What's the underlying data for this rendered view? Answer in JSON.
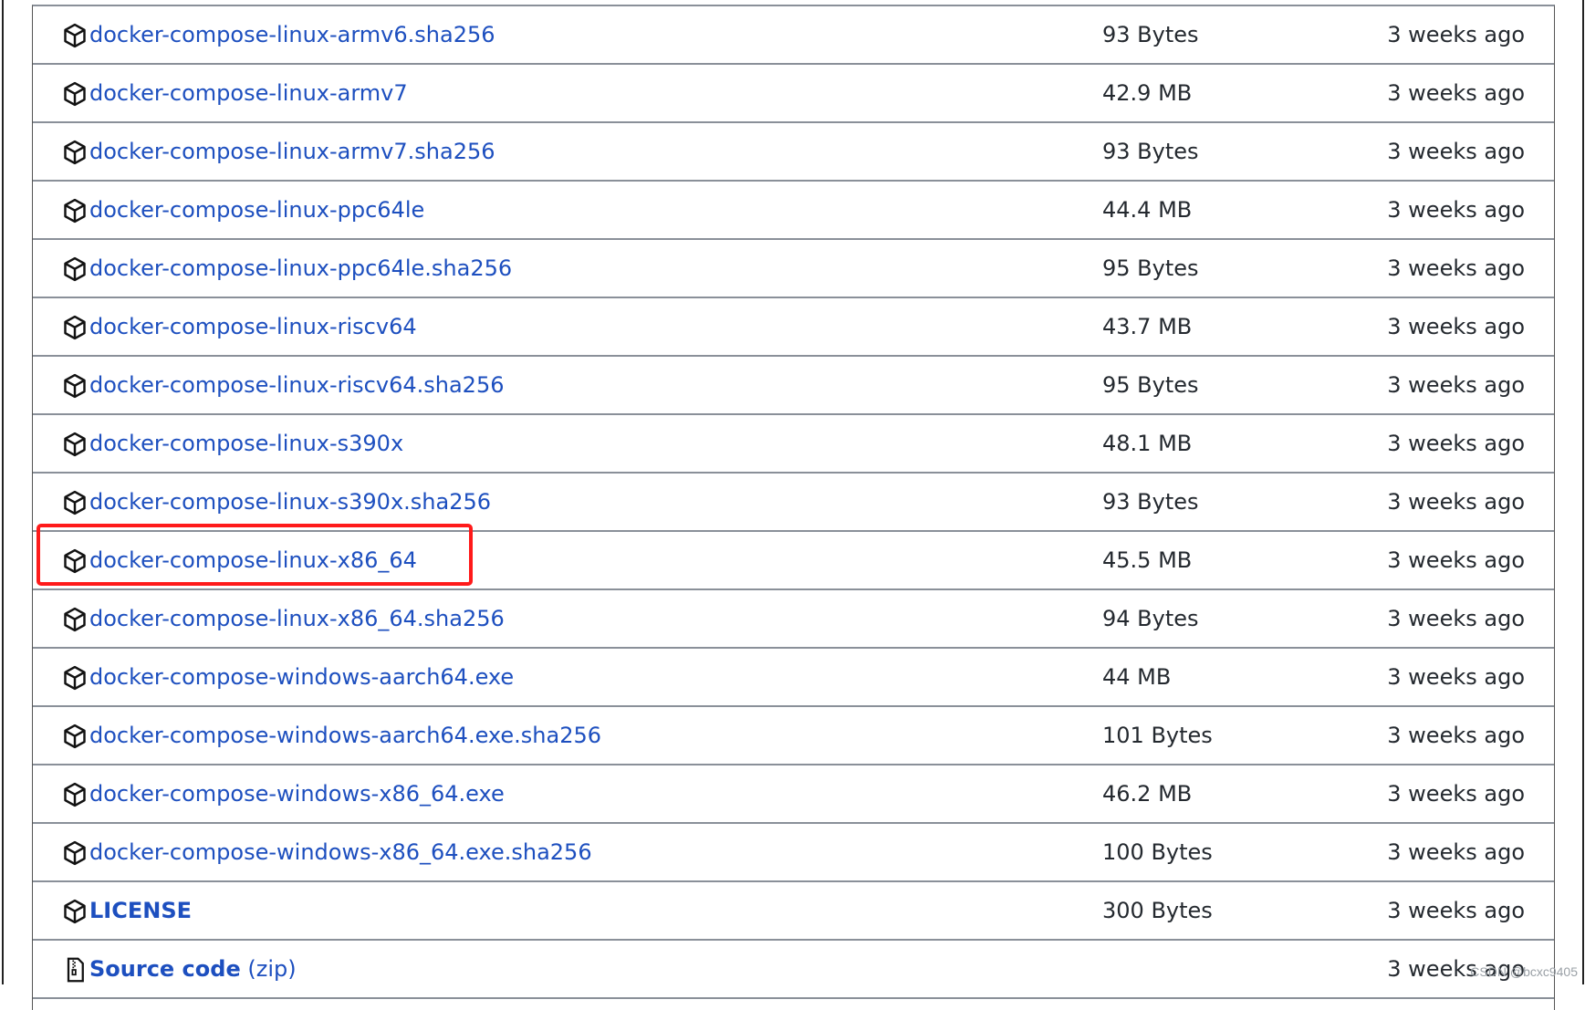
{
  "assets": [
    {
      "name": "docker-compose-linux-armv6.sha256",
      "size": "93 Bytes",
      "date": "3 weeks ago",
      "icon": "package-icon"
    },
    {
      "name": "docker-compose-linux-armv7",
      "size": "42.9 MB",
      "date": "3 weeks ago",
      "icon": "package-icon"
    },
    {
      "name": "docker-compose-linux-armv7.sha256",
      "size": "93 Bytes",
      "date": "3 weeks ago",
      "icon": "package-icon"
    },
    {
      "name": "docker-compose-linux-ppc64le",
      "size": "44.4 MB",
      "date": "3 weeks ago",
      "icon": "package-icon"
    },
    {
      "name": "docker-compose-linux-ppc64le.sha256",
      "size": "95 Bytes",
      "date": "3 weeks ago",
      "icon": "package-icon"
    },
    {
      "name": "docker-compose-linux-riscv64",
      "size": "43.7 MB",
      "date": "3 weeks ago",
      "icon": "package-icon"
    },
    {
      "name": "docker-compose-linux-riscv64.sha256",
      "size": "95 Bytes",
      "date": "3 weeks ago",
      "icon": "package-icon"
    },
    {
      "name": "docker-compose-linux-s390x",
      "size": "48.1 MB",
      "date": "3 weeks ago",
      "icon": "package-icon"
    },
    {
      "name": "docker-compose-linux-s390x.sha256",
      "size": "93 Bytes",
      "date": "3 weeks ago",
      "icon": "package-icon"
    },
    {
      "name": "docker-compose-linux-x86_64",
      "size": "45.5 MB",
      "date": "3 weeks ago",
      "icon": "package-icon",
      "highlighted": true
    },
    {
      "name": "docker-compose-linux-x86_64.sha256",
      "size": "94 Bytes",
      "date": "3 weeks ago",
      "icon": "package-icon"
    },
    {
      "name": "docker-compose-windows-aarch64.exe",
      "size": "44 MB",
      "date": "3 weeks ago",
      "icon": "package-icon"
    },
    {
      "name": "docker-compose-windows-aarch64.exe.sha256",
      "size": "101 Bytes",
      "date": "3 weeks ago",
      "icon": "package-icon"
    },
    {
      "name": "docker-compose-windows-x86_64.exe",
      "size": "46.2 MB",
      "date": "3 weeks ago",
      "icon": "package-icon"
    },
    {
      "name": "docker-compose-windows-x86_64.exe.sha256",
      "size": "100 Bytes",
      "date": "3 weeks ago",
      "icon": "package-icon"
    },
    {
      "name": "LICENSE",
      "size": "300 Bytes",
      "date": "3 weeks ago",
      "icon": "package-icon"
    }
  ],
  "source_code": {
    "name": "Source code",
    "suffix": "(zip)",
    "date": "3 weeks ago",
    "icon": "file-zip-icon"
  },
  "watermark": "CSDN @bcxc9405",
  "colors": {
    "link": "#1d4fbf",
    "text": "#24292f",
    "highlight": "#ff1a1a",
    "divider": "#8a9099"
  }
}
